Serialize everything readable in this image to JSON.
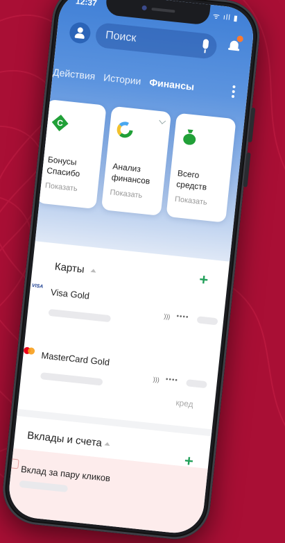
{
  "status_bar": {
    "time": "12:37",
    "icons": "ᯤ ıll ▮"
  },
  "search": {
    "placeholder": "Поиск"
  },
  "tabs": [
    {
      "label": "Действия"
    },
    {
      "label": "Истории"
    },
    {
      "label": "Финансы"
    }
  ],
  "cards": [
    {
      "title": "Бонусы Спасибо",
      "action": "Показать",
      "icon": "sber-spasibo-icon",
      "color": "#21a038"
    },
    {
      "title": "Анализ финансов",
      "action": "Показать",
      "icon": "pie-chart-icon",
      "color": "#21a038"
    },
    {
      "title": "Всего средств",
      "action": "Показать",
      "icon": "money-bag-icon",
      "color": "#21a038"
    }
  ],
  "sections": {
    "cards_title": "Карты",
    "deposits_title": "Вклады и счета"
  },
  "bank_cards": [
    {
      "logo": "VISA",
      "name": "Visa Gold",
      "masked": "••••"
    },
    {
      "name": "MasterCard Gold",
      "masked": "••••",
      "type": "кред"
    }
  ],
  "deposits": [
    {
      "name": "Вклад за пару кликов"
    }
  ],
  "colors": {
    "background": "#a90f35",
    "accent_green": "#21a038",
    "header_blue": "#3f7fd6"
  }
}
